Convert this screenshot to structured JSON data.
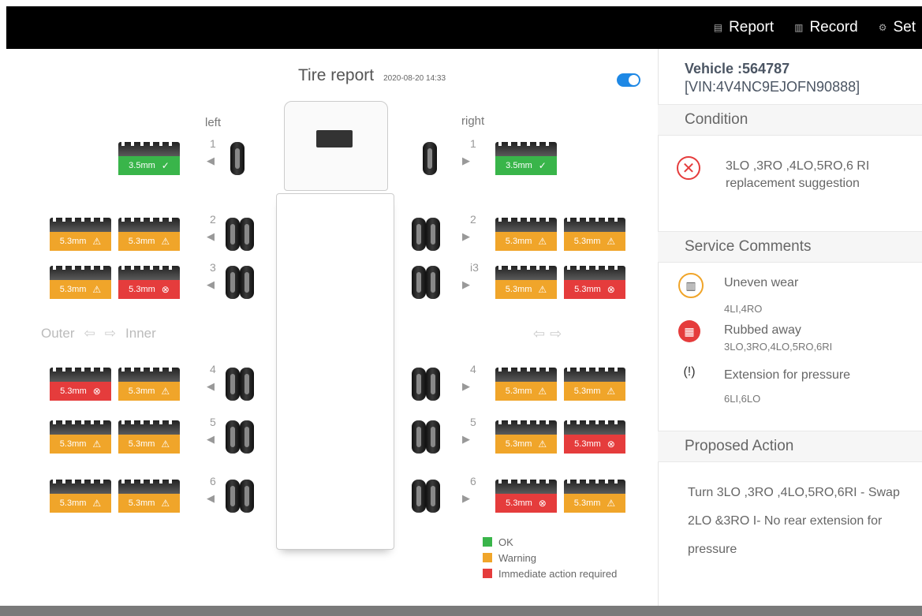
{
  "nav": {
    "report": {
      "label": "Report",
      "icon": "report-icon"
    },
    "record": {
      "label": "Record",
      "icon": "record-icon"
    },
    "set": {
      "label": "Set",
      "icon": "settings-icon"
    }
  },
  "report": {
    "title": "Tire report",
    "datetime": "2020-08-20 14:33",
    "left_label": "left",
    "right_label": "right",
    "outer_label": "Outer",
    "inner_label": "Inner"
  },
  "axles": [
    {
      "num": "1",
      "left": [
        {
          "value": "3.5mm",
          "status": "ok"
        }
      ],
      "right": [
        {
          "value": "3.5mm",
          "status": "ok"
        }
      ]
    },
    {
      "num": "2",
      "left": [
        {
          "value": "5.3mm",
          "status": "warn"
        },
        {
          "value": "5.3mm",
          "status": "warn"
        }
      ],
      "right": [
        {
          "value": "5.3mm",
          "status": "warn"
        },
        {
          "value": "5.3mm",
          "status": "warn"
        }
      ]
    },
    {
      "num": "3",
      "right_num": "i3",
      "left": [
        {
          "value": "5.3mm",
          "status": "warn"
        },
        {
          "value": "5.3mm",
          "status": "crit"
        }
      ],
      "right": [
        {
          "value": "5.3mm",
          "status": "warn"
        },
        {
          "value": "5.3mm",
          "status": "crit"
        }
      ]
    },
    {
      "num": "4",
      "left": [
        {
          "value": "5.3mm",
          "status": "crit"
        },
        {
          "value": "5.3mm",
          "status": "warn"
        }
      ],
      "right": [
        {
          "value": "5.3mm",
          "status": "warn"
        },
        {
          "value": "5.3mm",
          "status": "warn"
        }
      ]
    },
    {
      "num": "5",
      "left": [
        {
          "value": "5.3mm",
          "status": "warn"
        },
        {
          "value": "5.3mm",
          "status": "warn"
        }
      ],
      "right": [
        {
          "value": "5.3mm",
          "status": "warn"
        },
        {
          "value": "5.3mm",
          "status": "crit"
        }
      ]
    },
    {
      "num": "6",
      "left": [
        {
          "value": "5.3mm",
          "status": "warn"
        },
        {
          "value": "5.3mm",
          "status": "warn"
        }
      ],
      "right": [
        {
          "value": "5.3mm",
          "status": "crit"
        },
        {
          "value": "5.3mm",
          "status": "warn"
        }
      ]
    }
  ],
  "legend": [
    {
      "label": "OK",
      "color": "#39b54a"
    },
    {
      "label": "Warning",
      "color": "#f0a52a"
    },
    {
      "label": "Immediate action required",
      "color": "#e53c3c"
    }
  ],
  "vehicle": {
    "id_line": "Vehicle :564787",
    "vin_line": "[VIN:4V4NC9EJOFN90888]"
  },
  "condition": {
    "heading": "Condition",
    "icon": "error-circle-icon",
    "text": "3LO ,3RO ,4LO,5RO,6 RI replacement suggestion"
  },
  "comments": {
    "heading": "Service Comments",
    "items": [
      {
        "title": "Uneven wear",
        "sub": "4LI,4RO",
        "icon": "uneven-wear-icon",
        "color": "#f0a52a"
      },
      {
        "title": "Rubbed away",
        "sub": "3LO,3RO,4LO,5RO,6RI",
        "icon": "rubbed-away-icon",
        "color": "#e53c3c"
      },
      {
        "title": "Extension for pressure",
        "sub": "6LI,6LO",
        "icon": "pressure-warning-icon",
        "color": "#f0a52a"
      }
    ]
  },
  "action": {
    "heading": "Proposed Action",
    "text": "Turn 3LO ,3RO ,4LO,5RO,6RI - Swap 2LO &3RO I- No rear extension for pressure"
  },
  "colors": {
    "ok": "#39b54a",
    "warning": "#f0a52a",
    "critical": "#e53c3c",
    "toggle": "#1e88e5"
  }
}
